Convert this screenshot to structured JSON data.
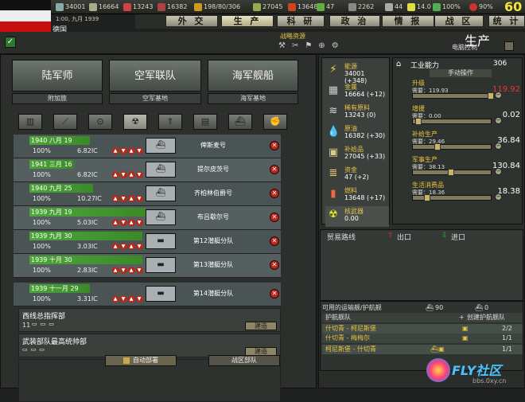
{
  "topbar": {
    "manpower": "34001",
    "ic": "16664",
    "energy": "13243",
    "metal": "16382",
    "oil": "198/80/306",
    "supplies": "27045",
    "money": "13648",
    "stock": "47",
    "mp2": "2262",
    "dissent": "44",
    "nuke": "14.0",
    "unity": "100%",
    "threat": "90%",
    "speed": "60"
  },
  "date": "1:00, 九月 1939",
  "country": "德国",
  "tabs": [
    "外 交",
    "生 产",
    "科 研",
    "政 治",
    "情 报",
    "战 区",
    "统 计"
  ],
  "subheader": {
    "title": "战略资源",
    "prod_title": "生产",
    "prod_sub": "电脑控制"
  },
  "units": [
    {
      "label": "陆军师",
      "sub": "附加旅"
    },
    {
      "label": "空军联队",
      "sub": "空军基地"
    },
    {
      "label": "海军舰船",
      "sub": "海军基地"
    }
  ],
  "queue": [
    {
      "date": "1940 八月 19",
      "pct": "100%",
      "ic": "6.82IC",
      "name": "俾斯麦号"
    },
    {
      "date": "1941 三月 16",
      "pct": "100%",
      "ic": "6.82IC",
      "name": "提尔皮茨号"
    },
    {
      "date": "1940 九月 25",
      "pct": "100%",
      "ic": "10.27IC",
      "name": "齐柏林伯爵号"
    },
    {
      "date": "1939 九月 19",
      "pct": "100%",
      "ic": "5.03IC",
      "name": "布吕歇尔号"
    },
    {
      "date": "1939 九月 30",
      "pct": "100%",
      "ic": "3.03IC",
      "name": "第12潜艇分队"
    },
    {
      "date": "1939 十月 30",
      "pct": "100%",
      "ic": "2.83IC",
      "name": "第13潜艇分队"
    },
    {
      "date": "1939 十一月 29",
      "pct": "100%",
      "ic": "3.31IC",
      "name": "第14潜艇分队"
    }
  ],
  "hq": [
    {
      "title": "西线总指挥部",
      "count": "11",
      "btn": "建造"
    },
    {
      "title": "武装部队最高统帅部",
      "btn": "建造"
    }
  ],
  "bottom": {
    "auto": "自动部署",
    "theater": "战区部队"
  },
  "resources": [
    {
      "label": "能源",
      "value": "34001 (+348)",
      "icon": "lightning-icon"
    },
    {
      "label": "金属",
      "value": "16664 (+12)",
      "icon": "metal-icon"
    },
    {
      "label": "稀有原料",
      "value": "13243 (0)",
      "icon": "rare-icon"
    },
    {
      "label": "原油",
      "value": "16382 (+30)",
      "icon": "oil-icon"
    },
    {
      "label": "补给品",
      "value": "27045 (+33)",
      "icon": "supply-icon"
    },
    {
      "label": "资金",
      "value": "47 (+2)",
      "icon": "money-icon"
    },
    {
      "label": "燃料",
      "value": "13648 (+17)",
      "icon": "fuel-icon"
    },
    {
      "label": "核武器",
      "value": "0.00",
      "icon": "nuke-icon"
    }
  ],
  "industry": {
    "title": "工业能力",
    "value": "306",
    "manual": "手动操作",
    "slots": [
      {
        "label": "升级",
        "req": "需要：119.93",
        "val": "119.92",
        "red": true,
        "knob": 95
      },
      {
        "label": "增援",
        "req": "需要：0.00",
        "val": "0.02",
        "knob": 4
      },
      {
        "label": "补给生产",
        "req": "需要：29.46",
        "val": "36.84",
        "knob": 28
      },
      {
        "label": "军事生产",
        "req": "需要：38.13",
        "val": "130.84",
        "knob": 45
      },
      {
        "label": "生活消费品",
        "req": "需要：18.36",
        "val": "18.38",
        "knob": 15
      }
    ]
  },
  "trade": {
    "title": "贸易路线",
    "export": "出口",
    "import": "进口"
  },
  "convoy": {
    "title": "可用的运输舰/护航舰",
    "transports": "90",
    "escorts": "0",
    "col1": "护航舰队",
    "col2": "创建护航舰队",
    "rows": [
      {
        "name": "什切青 - 柯尼斯堡",
        "val": "2/2"
      },
      {
        "name": "什切青 - 梅梅尔",
        "val": "1/1"
      },
      {
        "name": "柯尼斯堡 - 什切青",
        "val": "1/1"
      }
    ]
  },
  "watermark": {
    "brand": "FLY社区",
    "url": "bbs.0xy.cn"
  }
}
